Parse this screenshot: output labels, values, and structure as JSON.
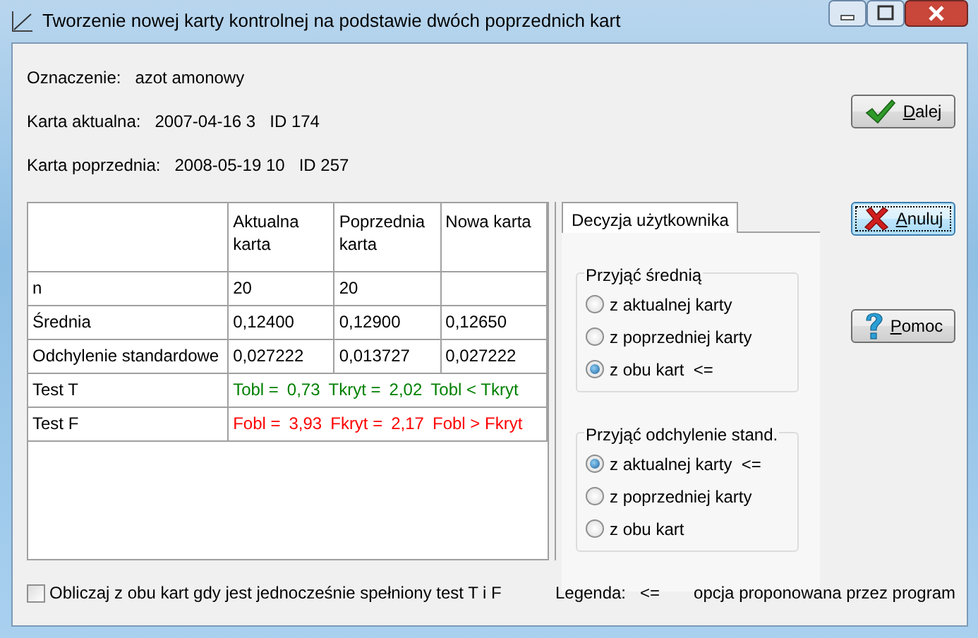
{
  "window": {
    "title": "Tworzenie nowej karty kontrolnej na podstawie dwóch poprzednich kart"
  },
  "info": [
    {
      "label": "Oznaczenie:",
      "values": [
        "azot amonowy"
      ]
    },
    {
      "label": "Karta aktualna:",
      "values": [
        "2007-04-16 3",
        "ID 174"
      ]
    },
    {
      "label": "Karta poprzednia:",
      "values": [
        "2008-05-19 10",
        "ID 257"
      ]
    }
  ],
  "table": {
    "columns": [
      "Aktualna karta",
      "Poprzednia karta",
      "Nowa karta"
    ],
    "rows": [
      {
        "kind": "values",
        "label": "n",
        "cells": [
          "20",
          "20"
        ]
      },
      {
        "kind": "values",
        "label": "Średnia",
        "cells": [
          "0,12400",
          "0,12900",
          "0,12650"
        ]
      },
      {
        "kind": "values",
        "label": "Odchylenie standardowe",
        "cells": [
          "0,027222",
          "0,013727",
          "0,027222"
        ]
      },
      {
        "kind": "test",
        "label": "Test T",
        "color": "#008000",
        "parts": [
          "Tobl =",
          "0,73",
          "Tkryt =",
          "2,02",
          "Tobl < Tkryt"
        ]
      },
      {
        "kind": "test",
        "label": "Test F",
        "color": "#ff0000",
        "parts": [
          "Fobl =",
          "3,93",
          "Fkryt =",
          "2,17",
          "Fobl > Fkryt"
        ]
      }
    ]
  },
  "tabs": [
    {
      "label": "Decyzja użytkownika",
      "selected": true
    }
  ],
  "groups": [
    {
      "title": "Przyjąć średnią",
      "options": [
        {
          "label": "z aktualnej karty",
          "selected": false
        },
        {
          "label": "z poprzedniej karty",
          "selected": false
        },
        {
          "label": "z obu kart  <=",
          "selected": true
        }
      ]
    },
    {
      "title": "Przyjąć odchylenie stand.",
      "options": [
        {
          "label": "z aktualnej karty  <=",
          "selected": true
        },
        {
          "label": "z poprzedniej karty",
          "selected": false
        },
        {
          "label": "z obu kart",
          "selected": false
        }
      ]
    }
  ],
  "buttons": [
    {
      "label": "Dalej",
      "kind": "check",
      "focused": false
    },
    {
      "label": "Anuluj",
      "kind": "cross",
      "focused": true
    },
    {
      "label": "Pomoc",
      "kind": "question",
      "focused": false
    }
  ],
  "checkbox": {
    "label": "Obliczaj z obu kart gdy jest jednocześnie spełniony test T i F",
    "checked": false
  },
  "legend": [
    "Legenda:",
    "<=",
    "opcja proponowana przez program"
  ]
}
